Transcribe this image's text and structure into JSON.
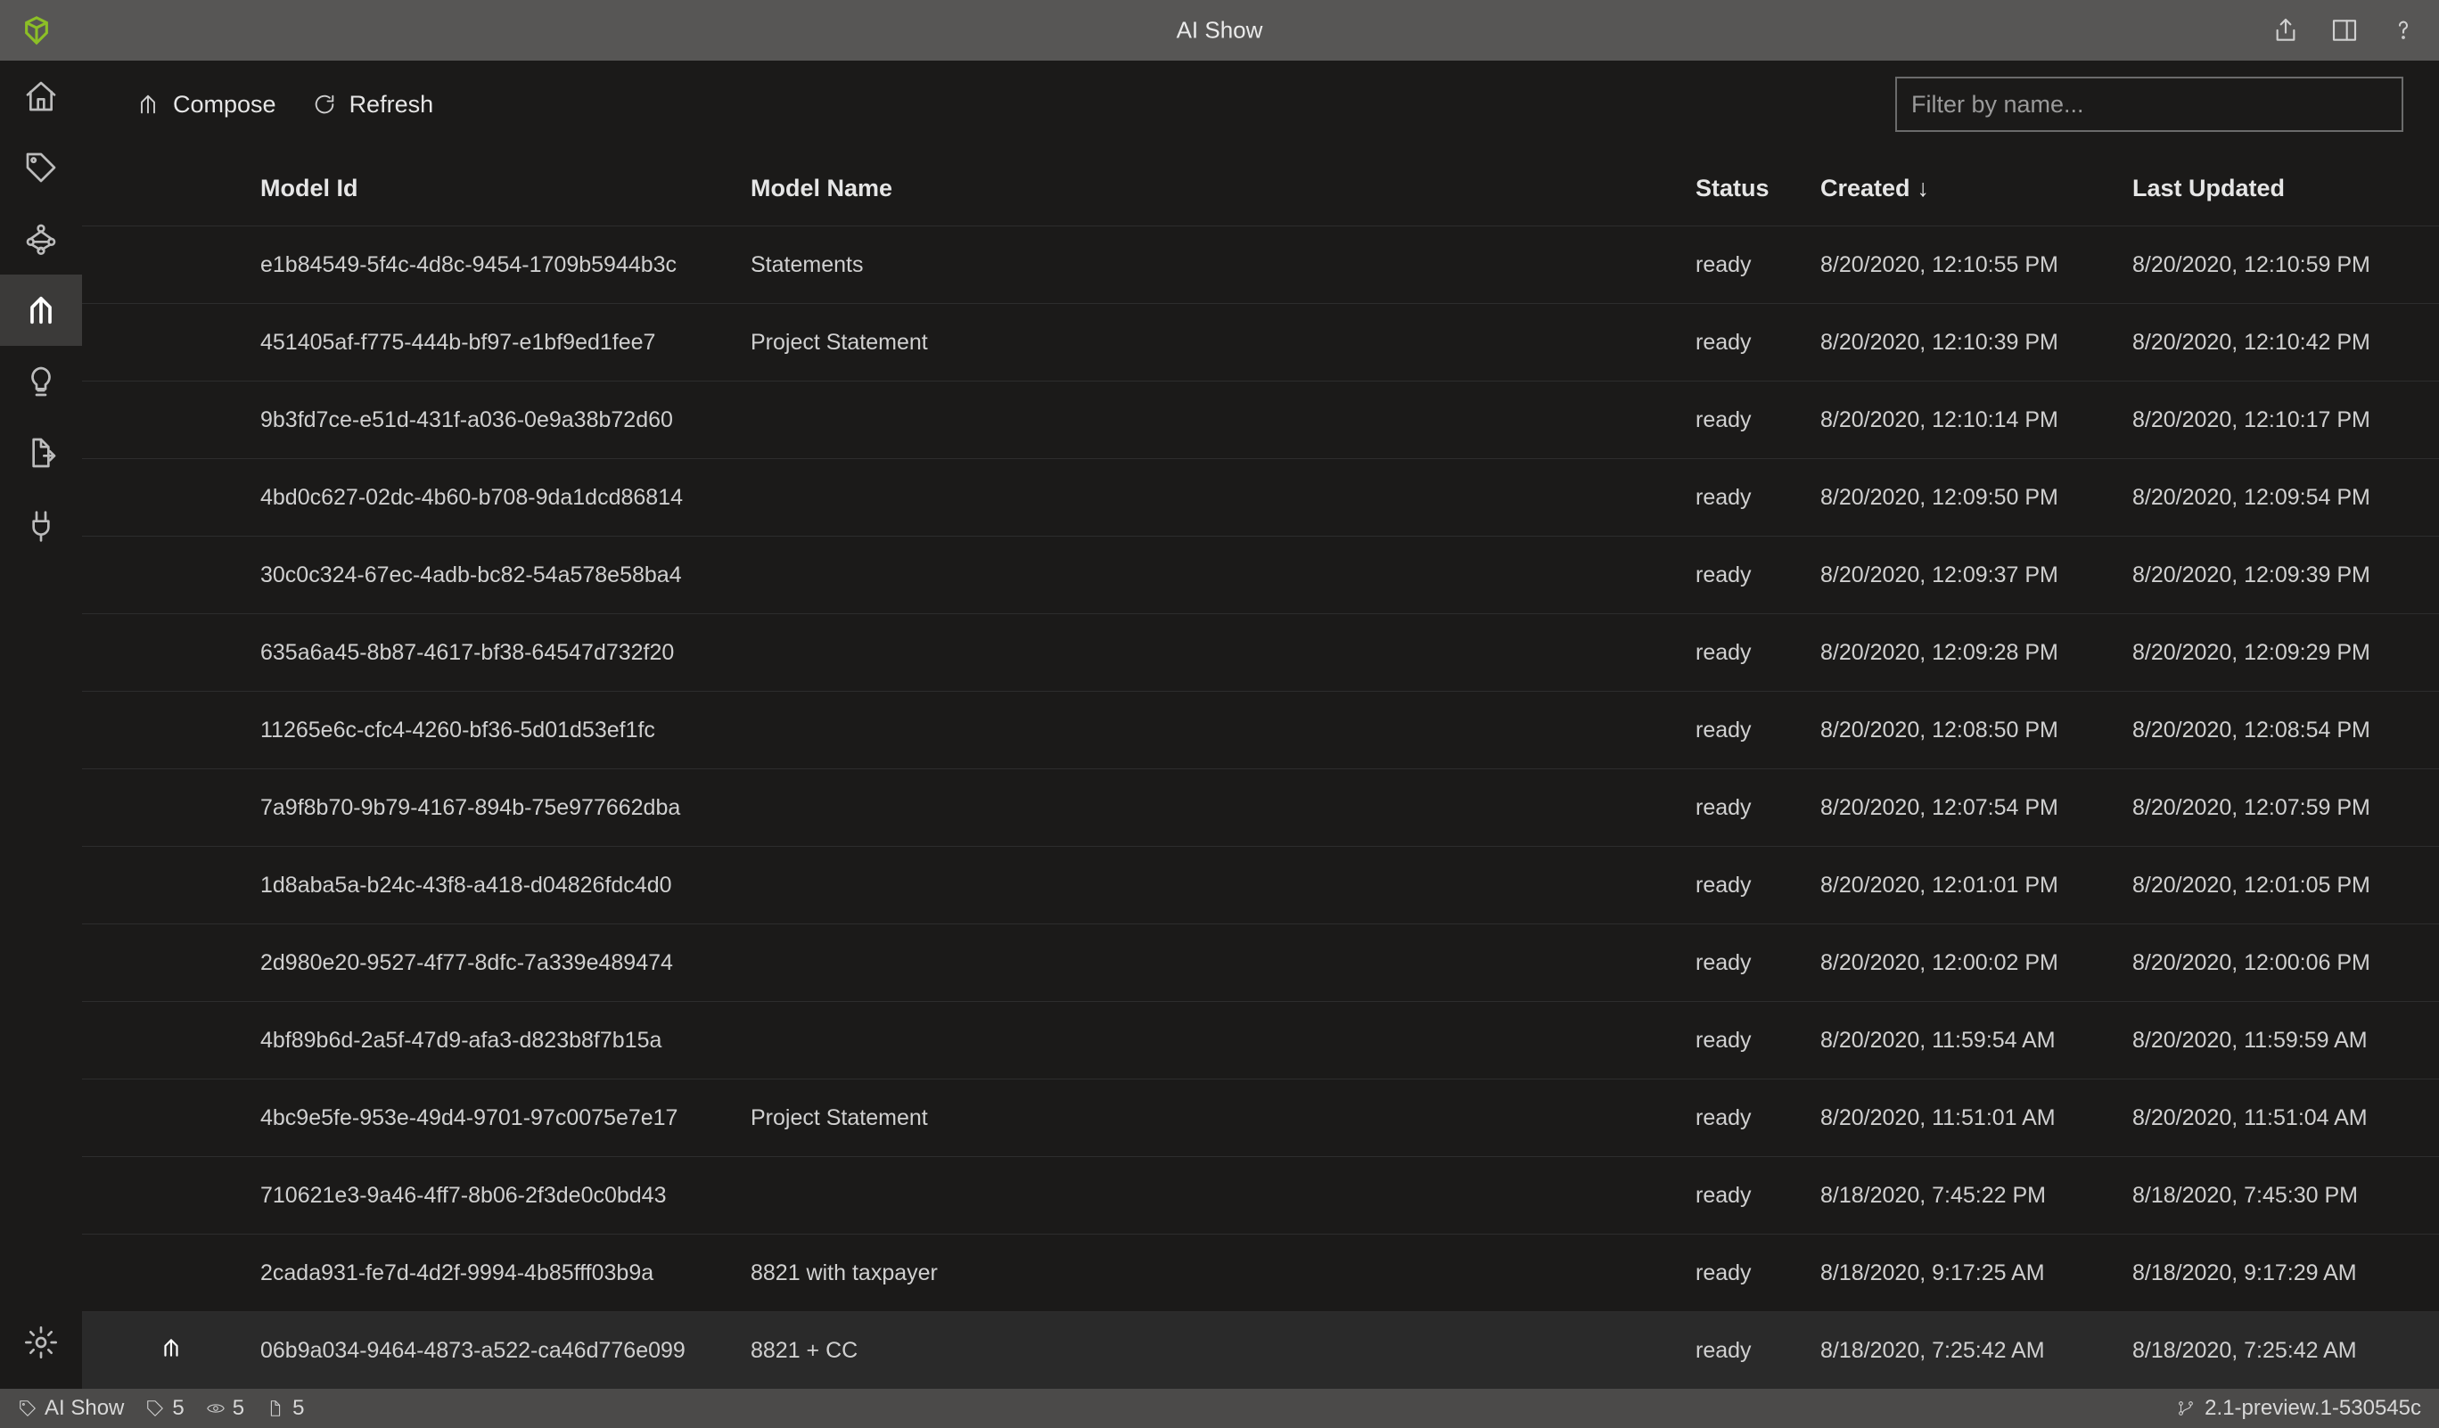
{
  "app": {
    "title": "AI Show",
    "brand_color": "#8cbf26"
  },
  "toolbar": {
    "compose_label": "Compose",
    "refresh_label": "Refresh"
  },
  "search": {
    "placeholder": "Filter by name...",
    "value": ""
  },
  "sidebar": {
    "items": [
      {
        "name": "home-icon"
      },
      {
        "name": "tag-icon"
      },
      {
        "name": "graph-icon"
      },
      {
        "name": "compose-icon",
        "selected": true
      },
      {
        "name": "lightbulb-icon"
      },
      {
        "name": "document-arrow-icon"
      },
      {
        "name": "plug-icon"
      }
    ],
    "bottom": [
      {
        "name": "settings-icon"
      }
    ]
  },
  "table": {
    "columns": {
      "model_id": "Model Id",
      "model_name": "Model Name",
      "status": "Status",
      "created": "Created",
      "last_updated": "Last Updated",
      "sort_indicator": "↓"
    },
    "rows": [
      {
        "id": "e1b84549-5f4c-4d8c-9454-1709b5944b3c",
        "name": "Statements",
        "status": "ready",
        "created": "8/20/2020, 12:10:55 PM",
        "updated": "8/20/2020, 12:10:59 PM"
      },
      {
        "id": "451405af-f775-444b-bf97-e1bf9ed1fee7",
        "name": "Project Statement",
        "status": "ready",
        "created": "8/20/2020, 12:10:39 PM",
        "updated": "8/20/2020, 12:10:42 PM"
      },
      {
        "id": "9b3fd7ce-e51d-431f-a036-0e9a38b72d60",
        "name": "",
        "status": "ready",
        "created": "8/20/2020, 12:10:14 PM",
        "updated": "8/20/2020, 12:10:17 PM"
      },
      {
        "id": "4bd0c627-02dc-4b60-b708-9da1dcd86814",
        "name": "",
        "status": "ready",
        "created": "8/20/2020, 12:09:50 PM",
        "updated": "8/20/2020, 12:09:54 PM"
      },
      {
        "id": "30c0c324-67ec-4adb-bc82-54a578e58ba4",
        "name": "",
        "status": "ready",
        "created": "8/20/2020, 12:09:37 PM",
        "updated": "8/20/2020, 12:09:39 PM"
      },
      {
        "id": "635a6a45-8b87-4617-bf38-64547d732f20",
        "name": "",
        "status": "ready",
        "created": "8/20/2020, 12:09:28 PM",
        "updated": "8/20/2020, 12:09:29 PM"
      },
      {
        "id": "11265e6c-cfc4-4260-bf36-5d01d53ef1fc",
        "name": "",
        "status": "ready",
        "created": "8/20/2020, 12:08:50 PM",
        "updated": "8/20/2020, 12:08:54 PM"
      },
      {
        "id": "7a9f8b70-9b79-4167-894b-75e977662dba",
        "name": "",
        "status": "ready",
        "created": "8/20/2020, 12:07:54 PM",
        "updated": "8/20/2020, 12:07:59 PM"
      },
      {
        "id": "1d8aba5a-b24c-43f8-a418-d04826fdc4d0",
        "name": "",
        "status": "ready",
        "created": "8/20/2020, 12:01:01 PM",
        "updated": "8/20/2020, 12:01:05 PM"
      },
      {
        "id": "2d980e20-9527-4f77-8dfc-7a339e489474",
        "name": "",
        "status": "ready",
        "created": "8/20/2020, 12:00:02 PM",
        "updated": "8/20/2020, 12:00:06 PM"
      },
      {
        "id": "4bf89b6d-2a5f-47d9-afa3-d823b8f7b15a",
        "name": "",
        "status": "ready",
        "created": "8/20/2020, 11:59:54 AM",
        "updated": "8/20/2020, 11:59:59 AM"
      },
      {
        "id": "4bc9e5fe-953e-49d4-9701-97c0075e7e17",
        "name": "Project Statement",
        "status": "ready",
        "created": "8/20/2020, 11:51:01 AM",
        "updated": "8/20/2020, 11:51:04 AM"
      },
      {
        "id": "710621e3-9a46-4ff7-8b06-2f3de0c0bd43",
        "name": "",
        "status": "ready",
        "created": "8/18/2020, 7:45:22 PM",
        "updated": "8/18/2020, 7:45:30 PM"
      },
      {
        "id": "2cada931-fe7d-4d2f-9994-4b85fff03b9a",
        "name": "8821 with taxpayer",
        "status": "ready",
        "created": "8/18/2020, 9:17:25 AM",
        "updated": "8/18/2020, 9:17:29 AM"
      },
      {
        "id": "06b9a034-9464-4873-a522-ca46d776e099",
        "name": "8821 + CC",
        "status": "ready",
        "created": "8/18/2020, 7:25:42 AM",
        "updated": "8/18/2020, 7:25:42 AM",
        "selected": true
      }
    ]
  },
  "statusbar": {
    "project_label": "AI Show",
    "tags_count": "5",
    "connections_count": "5",
    "docs_count": "5",
    "version": "2.1-preview.1-530545c"
  }
}
